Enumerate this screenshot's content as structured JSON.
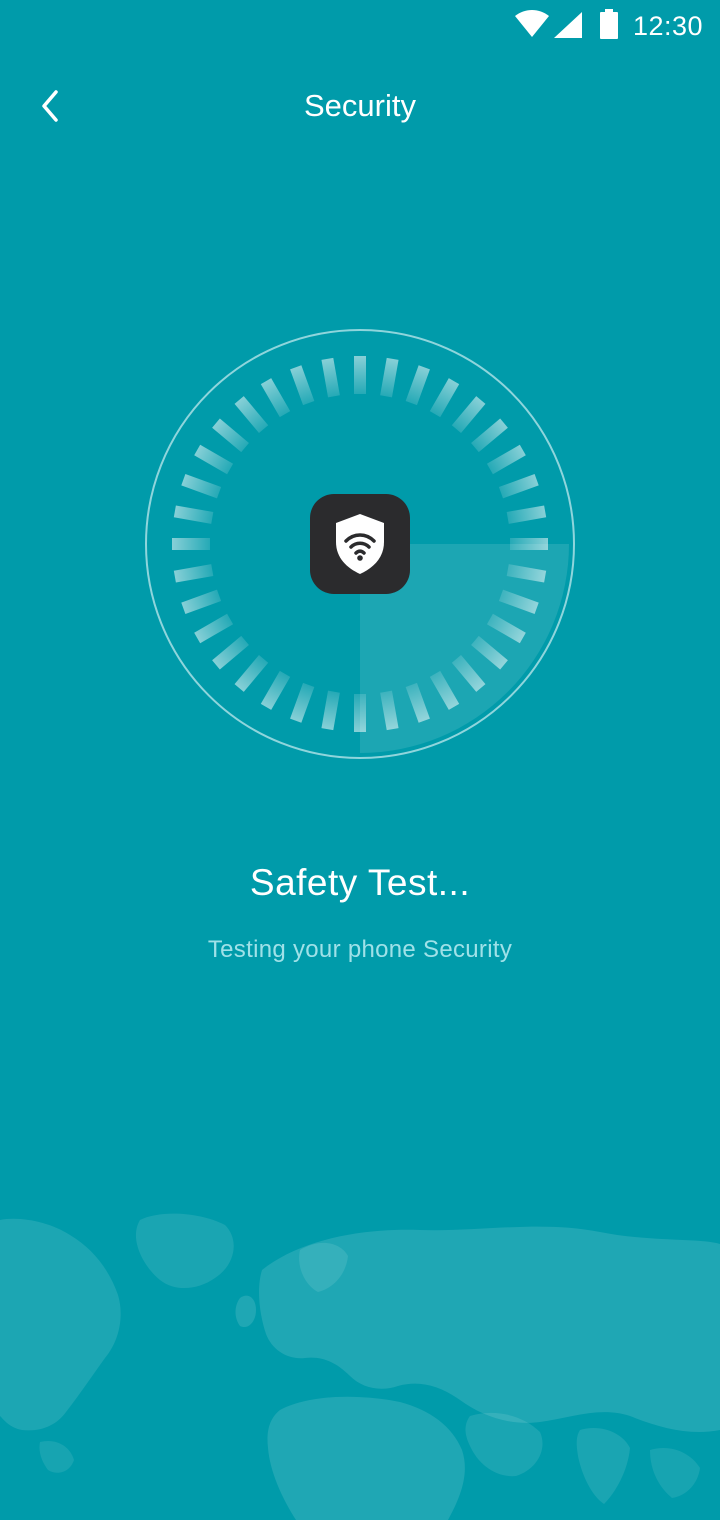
{
  "status_bar": {
    "time": "12:30",
    "wifi_icon": "wifi-icon",
    "signal_icon": "cellular-signal-icon",
    "battery_icon": "battery-icon"
  },
  "header": {
    "title": "Security",
    "back_icon": "chevron-left-icon"
  },
  "scanner": {
    "center_icon": "shield-wifi-icon",
    "sweep_icon": "radar-sweep"
  },
  "main": {
    "title": "Safety Test...",
    "subtitle": "Testing your phone Security"
  },
  "decoration": {
    "background_icon": "world-map-icon"
  },
  "colors": {
    "background": "#009BAA",
    "text": "#FFFFFF",
    "subtitle_text": "#9FE1E8",
    "icon_tile": "#2B2B2D"
  }
}
